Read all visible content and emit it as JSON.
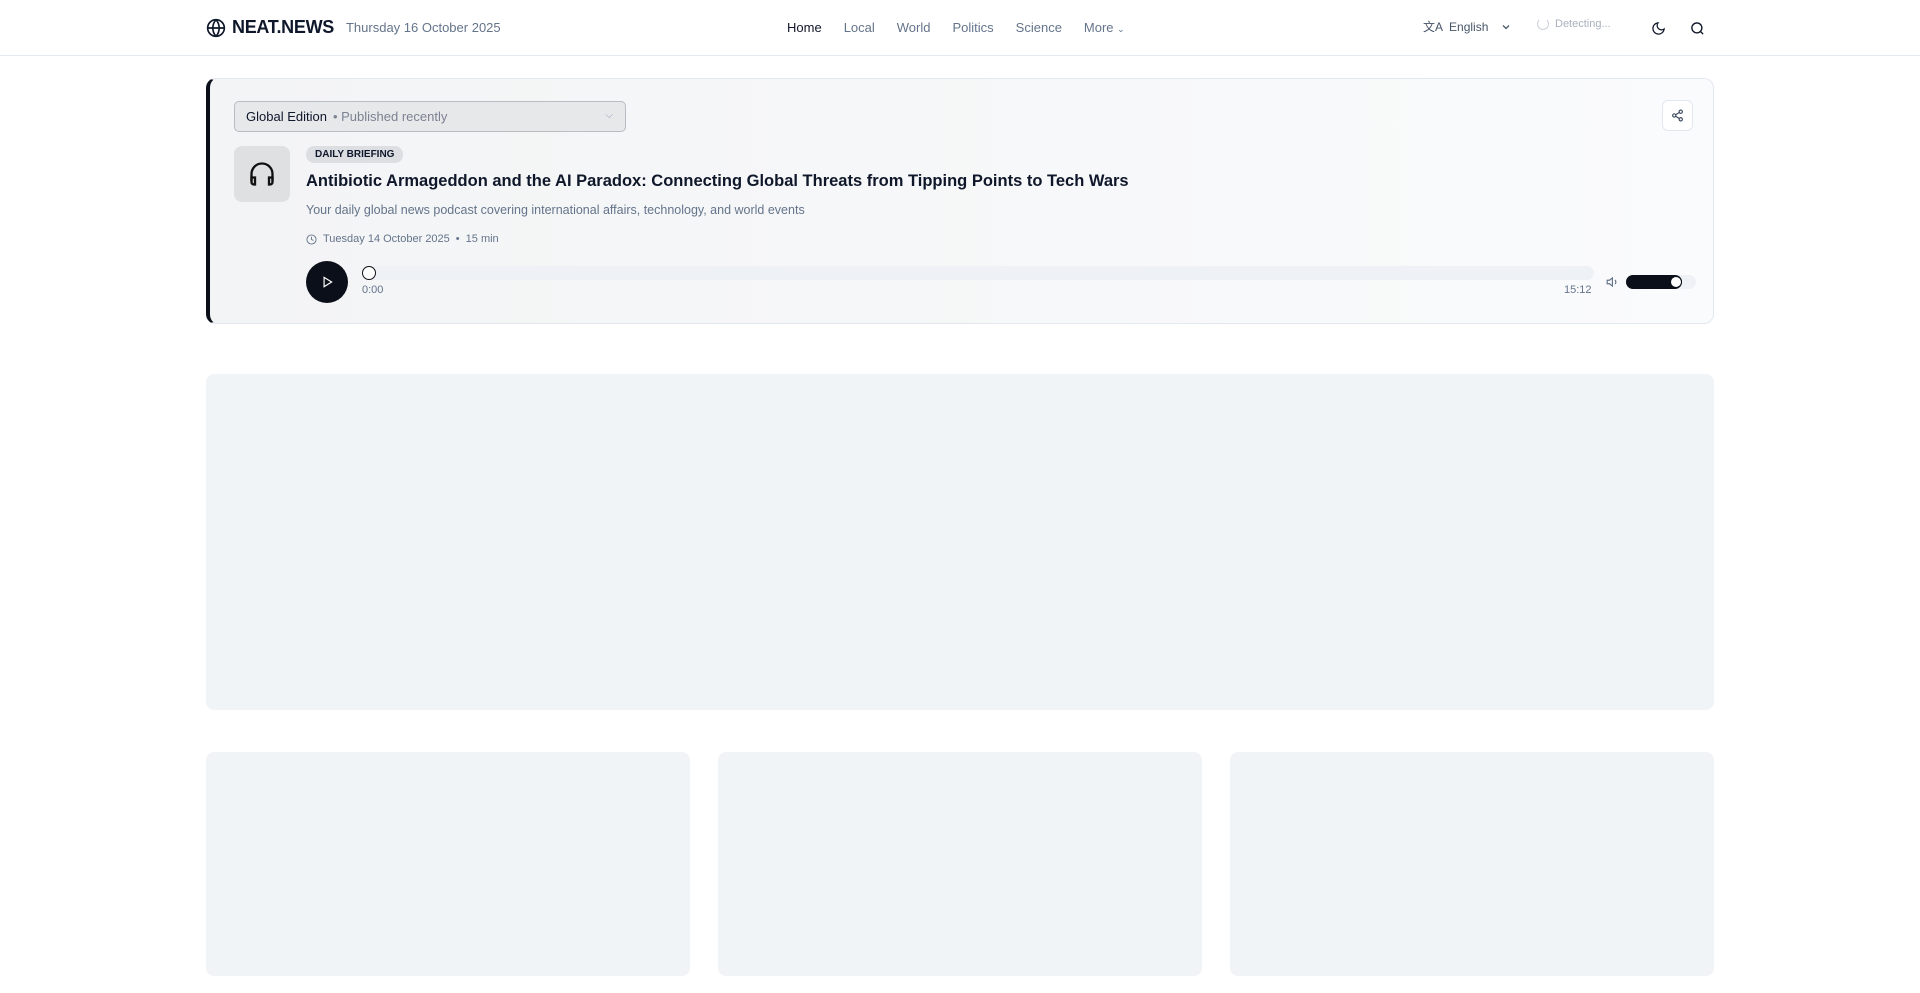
{
  "header": {
    "brand": "NEAT.NEWS",
    "date": "Thursday 16 October 2025",
    "nav": [
      {
        "label": "Home"
      },
      {
        "label": "Local"
      },
      {
        "label": "World"
      },
      {
        "label": "Politics"
      },
      {
        "label": "Science"
      },
      {
        "label": "More"
      }
    ],
    "language": "English",
    "location": "Detecting..."
  },
  "podcast": {
    "edition": "Global Edition",
    "edition_status": "• Published recently",
    "badge": "DAILY BRIEFING",
    "title": "Antibiotic Armageddon and the AI Paradox: Connecting Global Threats from Tipping Points to Tech Wars",
    "description": "Your daily global news podcast covering international affairs, technology, and world events",
    "date": "Tuesday 14 October 2025",
    "duration": "15 min",
    "current_time": "0:00",
    "total_time": "15:12",
    "progress_percent": 0,
    "volume_percent": 80
  }
}
